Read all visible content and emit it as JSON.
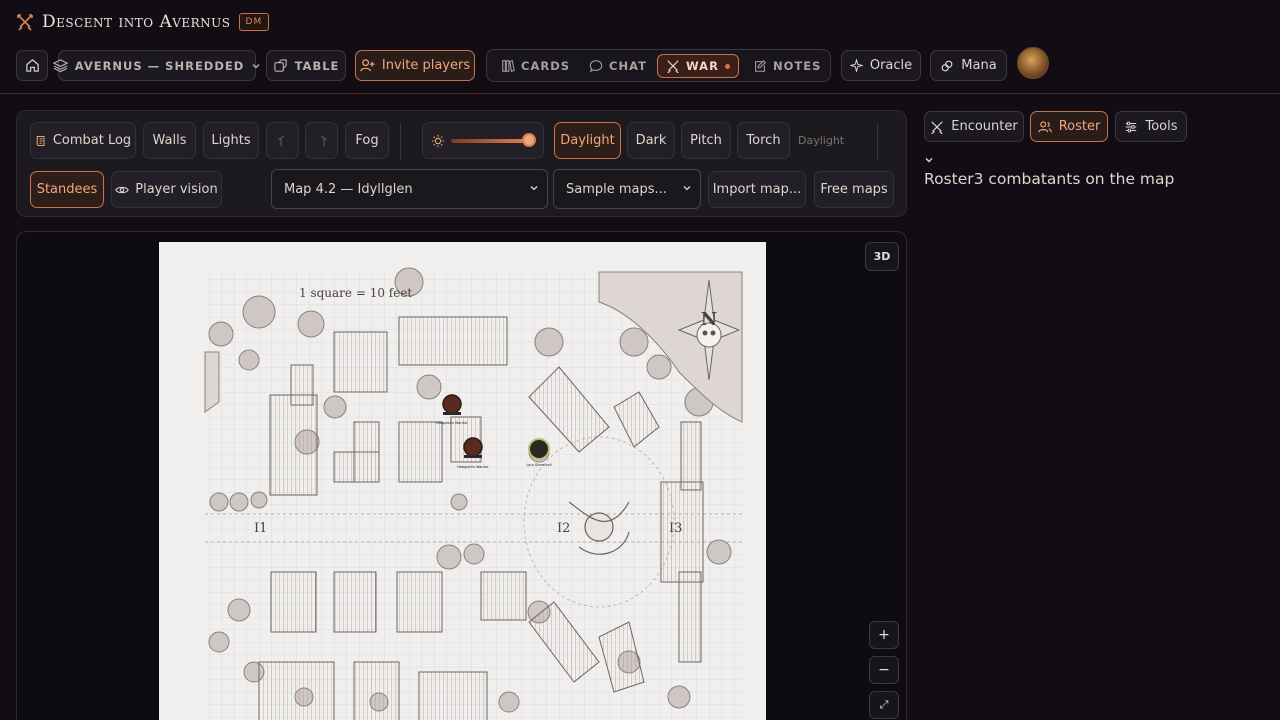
{
  "header": {
    "app_title": "Descent into Avernus",
    "role_badge": "DM",
    "campaign_label": "AVERNUS — SHREDDED",
    "table_label": "TABLE",
    "invite_label": "Invite players",
    "nav": {
      "cards": "CARDS",
      "chat": "CHAT",
      "war": "WAR",
      "notes": "NOTES"
    },
    "oracle_label": "Oracle",
    "mana_label": "Mana"
  },
  "toolbar": {
    "combat_log": "Combat Log",
    "walls": "Walls",
    "lights": "Lights",
    "fog": "Fog",
    "lighting_modes": [
      "Daylight",
      "Dark",
      "Pitch",
      "Torch"
    ],
    "active_mode": "Daylight",
    "mode_status": "Daylight",
    "brightness_level": 1.0,
    "standees": "Standees",
    "player_vision": "Player vision",
    "map_select": "Map 4.2 — Idyllglen",
    "sample_maps": "Sample maps...",
    "import_map": "Import map...",
    "free_maps": "Free maps"
  },
  "map": {
    "scale_note": "1 square = 10 feet",
    "compass": "N",
    "area_labels": [
      "I1",
      "I2",
      "I3"
    ],
    "tokens": [
      {
        "name": "Hobgoblin Warrior"
      },
      {
        "name": "Hobgoblin Warrior"
      },
      {
        "name": "Lyra Stormveil"
      }
    ],
    "view_3d": "3D",
    "zoom_in": "+",
    "zoom_out": "−",
    "fit": "⤢"
  },
  "sidebar": {
    "tabs": [
      "Encounter",
      "Roster",
      "Tools"
    ],
    "active_tab": "Roster",
    "roster_text": "Roster3 combatants on the map"
  },
  "colors": {
    "accent": "#c8734a",
    "background": "#120d14",
    "panel": "#1c1a1f"
  }
}
